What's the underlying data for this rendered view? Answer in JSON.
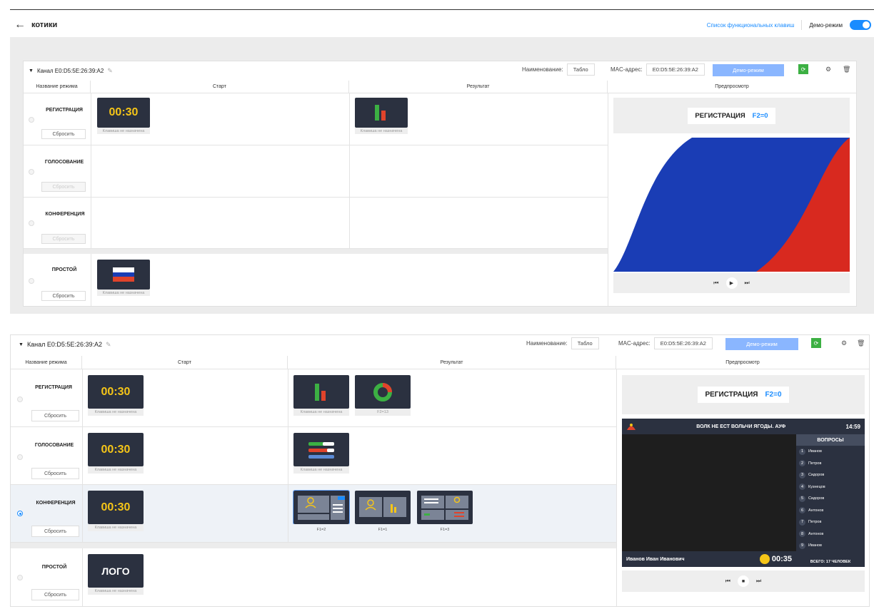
{
  "header": {
    "title": "котики",
    "keys_link": "Список функциональных клавиш",
    "demo_label": "Демо-режим"
  },
  "channel1": {
    "title": "Канал E0:D5:5E:26:39:A2",
    "name_label": "Наименование:",
    "name_value": "Табло",
    "mac_label": "MAC-адрес:",
    "mac_value": "E0:D5:5E:26:39:A2",
    "demo_button": "Демо-режим",
    "cols": [
      "Название режима",
      "Старт",
      "Результат",
      "Предпросмотр"
    ],
    "modes": [
      "РЕГИСТРАЦИЯ",
      "ГОЛОСОВАНИЕ",
      "КОНФЕРЕНЦИЯ",
      "ПРОСТОЙ"
    ],
    "reset": "Сбросить",
    "timer": "00:30",
    "no_key": "Клавиша не назначена",
    "preview": {
      "mode": "РЕГИСТРАЦИЯ",
      "key": "F2=0"
    }
  },
  "channel2": {
    "title": "Канал E0:D5:5E:26:39:A2",
    "name_label": "Наименование:",
    "name_value": "Табло",
    "mac_label": "MAC-адрес:",
    "mac_value": "E0:D5:5E:26:39:A2",
    "demo_button": "Демо-режим",
    "cols": [
      "Название режима",
      "Старт",
      "Результат",
      "Предпросмотр"
    ],
    "modes": [
      "РЕГИСТРАЦИЯ",
      "ГОЛОСОВАНИЕ",
      "КОНФЕРЕНЦИЯ",
      "ПРОСТОЙ"
    ],
    "reset": "Сбросить",
    "timer": "00:30",
    "no_key": "Клавиша не назначена",
    "logo": "ЛОГО",
    "result_keys": {
      "reg2": "F2=13",
      "conf1": "F1=2",
      "conf2": "F1=1",
      "conf3": "F1=3"
    },
    "preview": {
      "mode": "РЕГИСТРАЦИЯ",
      "key": "F2=0",
      "screen_title": "ВОЛК НЕ ЕСТ ВОЛЬЧИ ЯГОДЫ. АУФ",
      "time": "14:59",
      "questions": "ВОПРОСЫ",
      "speaker": "Иванов Иван Иванович",
      "countdown": "00:35",
      "total": "ВСЕГО: 17 ЧЕЛОВЕК",
      "names": [
        "Иванов",
        "Петров",
        "Сидоров",
        "Кузнецов",
        "Сидоров",
        "Антонов",
        "Петров",
        "Антонов",
        "Иванов"
      ]
    }
  },
  "colors": {
    "accent": "#1a8cff",
    "thumb_bg": "#2b3140",
    "timer": "#f5c518",
    "green": "#3cb043"
  }
}
